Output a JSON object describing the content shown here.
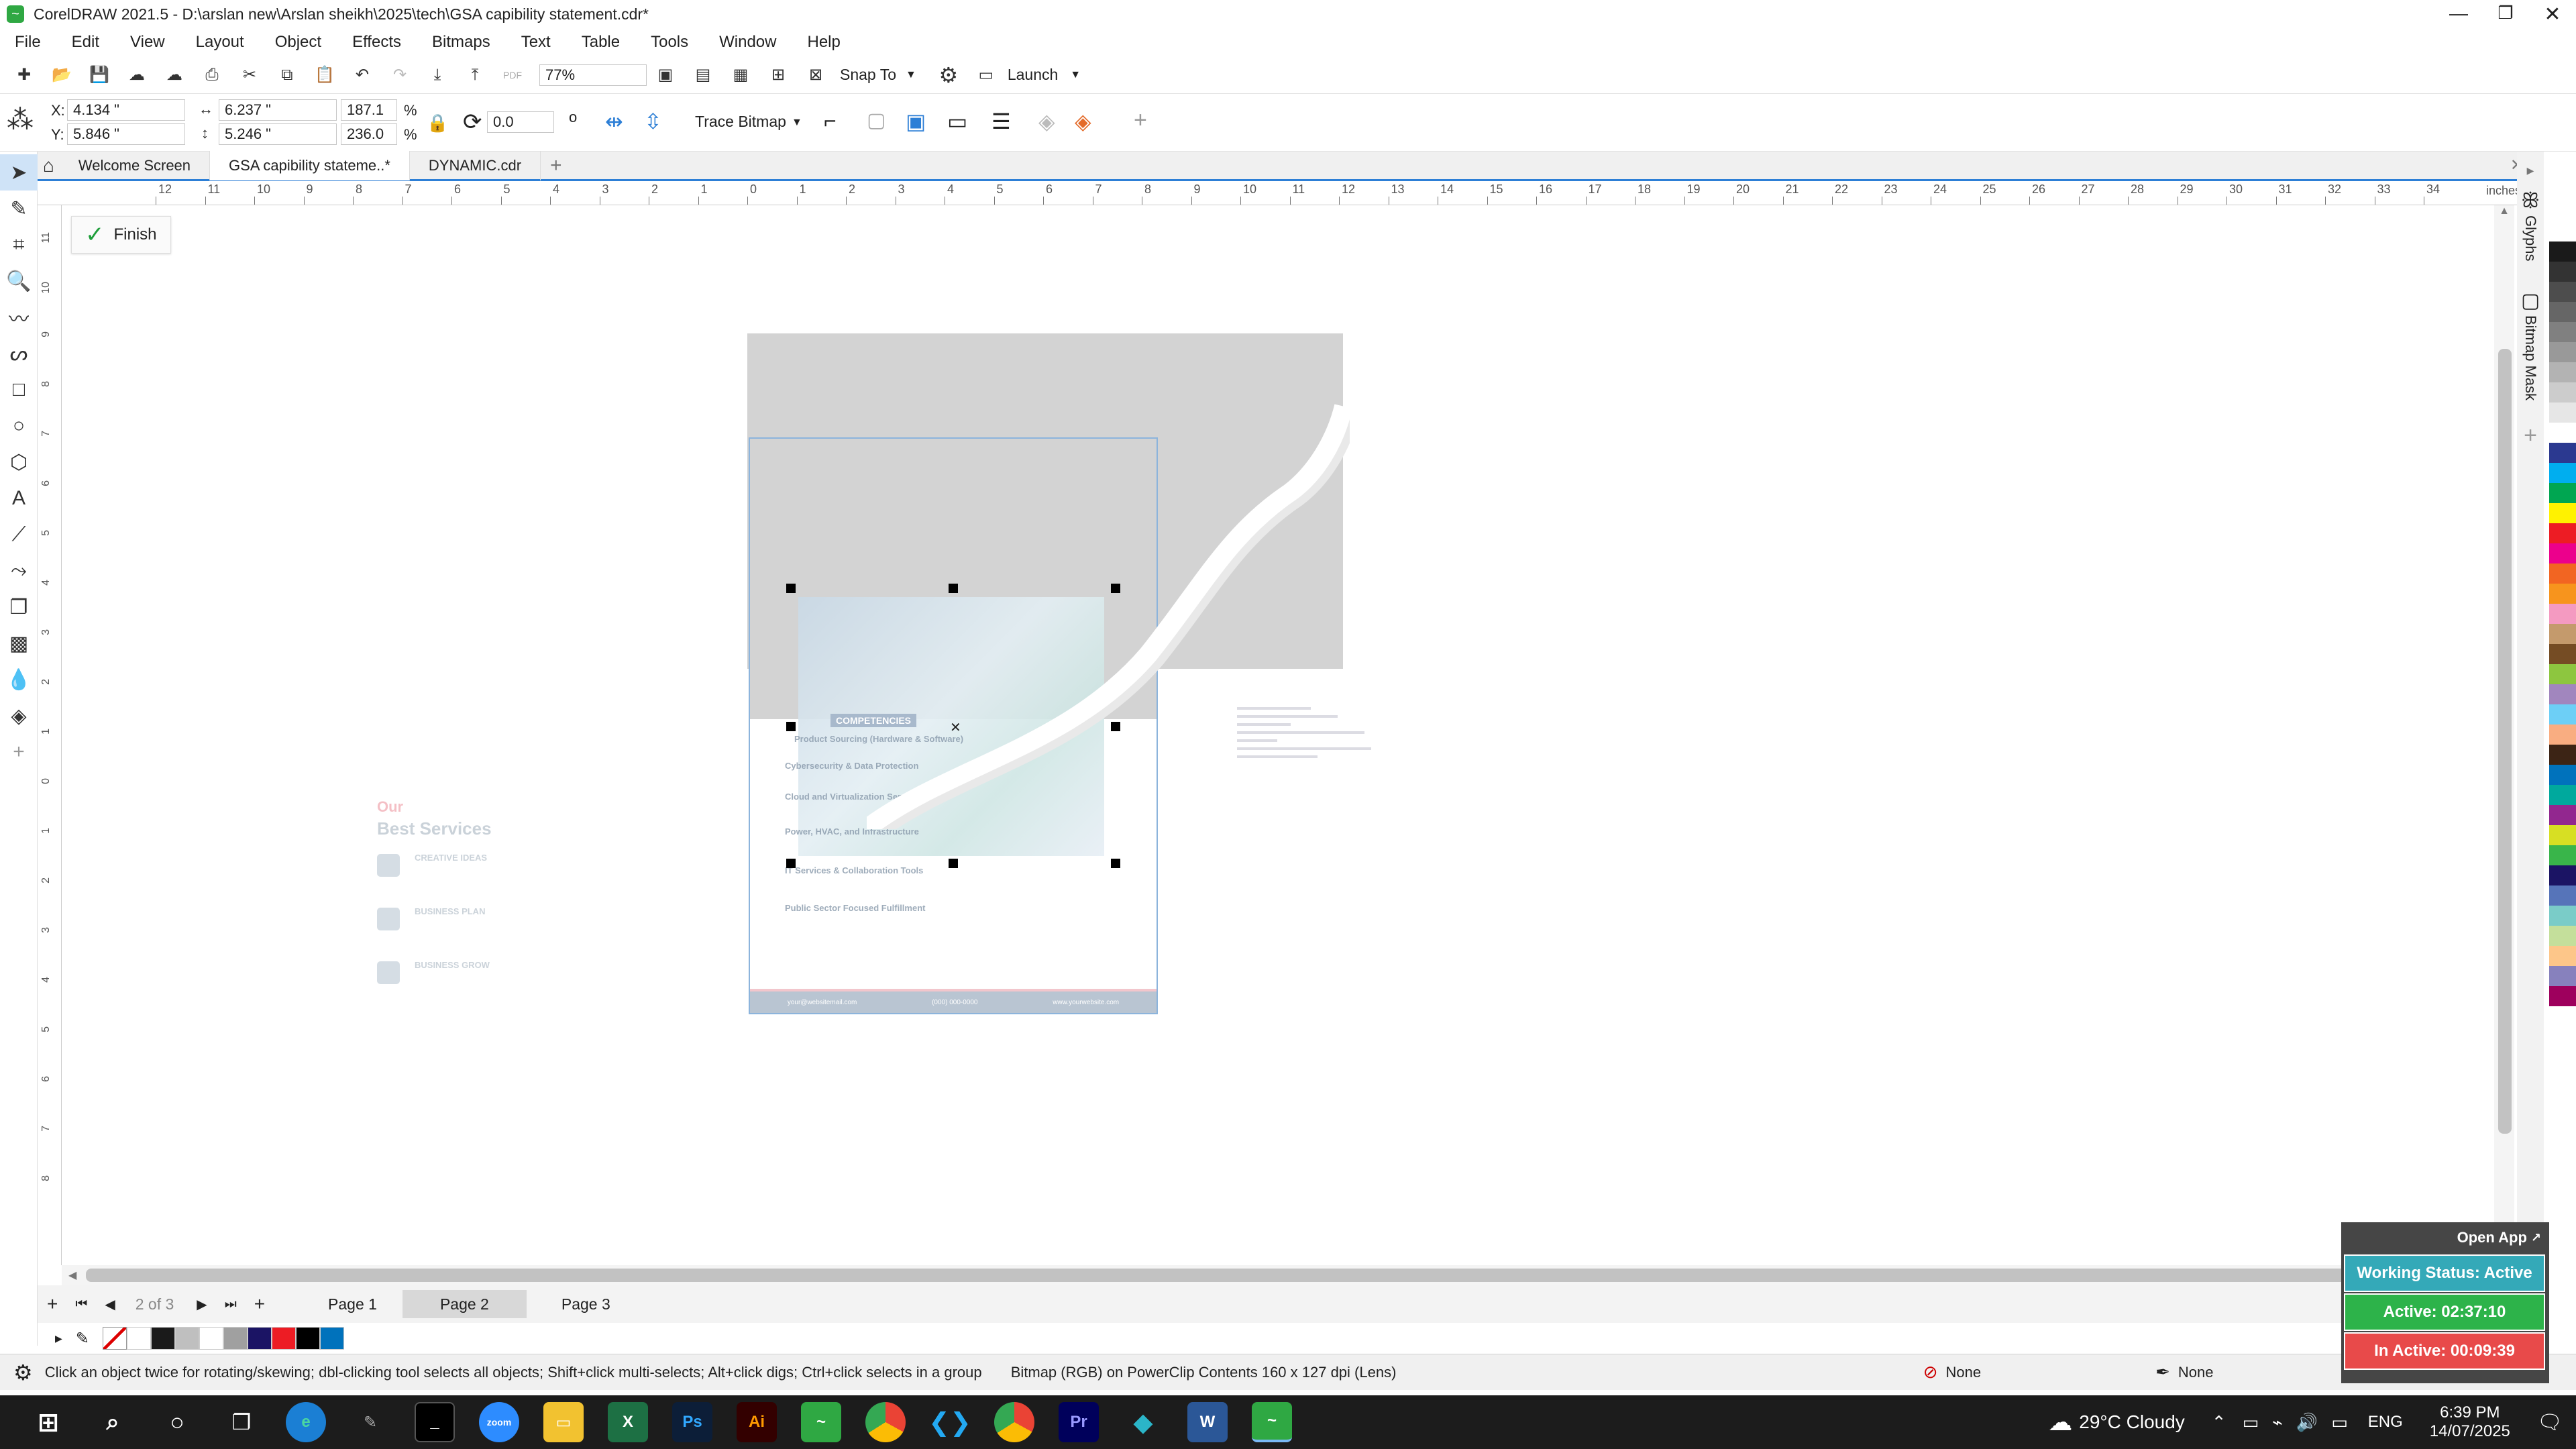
{
  "window": {
    "title": "CorelDRAW 2021.5 - D:\\arslan new\\Arslan sheikh\\2025\\tech\\GSA  capibility statement.cdr*"
  },
  "menu": [
    "File",
    "Edit",
    "View",
    "Layout",
    "Object",
    "Effects",
    "Bitmaps",
    "Text",
    "Table",
    "Tools",
    "Window",
    "Help"
  ],
  "toolbar": {
    "zoom": "77%",
    "snap_to": "Snap To",
    "launch": "Launch"
  },
  "properties": {
    "x_label": "X:",
    "x": "4.134 \"",
    "y_label": "Y:",
    "y": "5.846 \"",
    "w": "6.237 \"",
    "h": "5.246 \"",
    "scale_w": "187.1",
    "scale_h": "236.0",
    "pct": "%",
    "rotation": "0.0",
    "degree_symbol": "o",
    "trace_bitmap": "Trace Bitmap"
  },
  "doc_tabs": [
    "Welcome Screen",
    "GSA  capibility stateme..*",
    "DYNAMIC.cdr"
  ],
  "ruler": {
    "unit": "inches",
    "labels": [
      "12",
      "11",
      "10",
      "9",
      "8",
      "7",
      "6",
      "5",
      "4",
      "3",
      "2",
      "1",
      "0",
      "1",
      "2",
      "3",
      "4",
      "5",
      "6",
      "7",
      "8",
      "9",
      "10",
      "11",
      "12",
      "13",
      "14",
      "15",
      "16",
      "17",
      "18",
      "19",
      "20",
      "21",
      "22",
      "23",
      "24",
      "25",
      "26",
      "27",
      "28",
      "29",
      "30",
      "31",
      "32",
      "33",
      "34"
    ],
    "vlabels": [
      "11",
      "10",
      "9",
      "8",
      "7",
      "6",
      "5",
      "4",
      "3",
      "2",
      "1",
      "0",
      "1",
      "2",
      "3",
      "4",
      "5",
      "6",
      "7",
      "8"
    ],
    "v_unit": "inches"
  },
  "finish_label": "Finish",
  "offpage": {
    "our": "Our",
    "best": "Best Services",
    "items": [
      "CREATIVE IDEAS",
      "BUSINESS PLAN",
      "BUSINESS GROW"
    ]
  },
  "page_content": {
    "section": "COMPETENCIES",
    "items": [
      "Product Sourcing (Hardware & Software)",
      "Cybersecurity & Data Protection",
      "Cloud and Virtualization Services",
      "Power, HVAC, and Infrastructure",
      "IT Services & Collaboration Tools",
      "Public Sector Focused Fulfillment"
    ],
    "footer": [
      "your@websitemail.com",
      "(000) 000-0000",
      "www.yourwebsite.com"
    ]
  },
  "docker_tabs": [
    "Glyphs",
    "Bitmap Mask"
  ],
  "palette_colors": [
    "#1a1a1a",
    "#333333",
    "#4d4d4d",
    "#666666",
    "#808080",
    "#999999",
    "#b3b3b3",
    "#cccccc",
    "#e6e6e6",
    "#ffffff",
    "#2b3990",
    "#00aeef",
    "#00a651",
    "#fff200",
    "#ed1c24",
    "#ec008c",
    "#f26522",
    "#f7941d",
    "#f49ac1",
    "#c49a6c",
    "#754c24",
    "#8dc63f",
    "#a186be",
    "#6dcff6",
    "#f9ad81",
    "#3c2415",
    "#0072bc",
    "#00a99d",
    "#92278f",
    "#d7df23",
    "#39b54a",
    "#1b1464",
    "#5674b9",
    "#7accc8",
    "#c4df9b",
    "#fdc689",
    "#8781bd",
    "#9e005d"
  ],
  "pages": {
    "counter": "2 of 3",
    "tabs": [
      "Page 1",
      "Page 2",
      "Page 3"
    ],
    "active": "Page 2"
  },
  "doc_palette": [
    "#ffffff",
    "#1a1a1a",
    "#bfbfbf",
    "#ffffff",
    "#a0a0a0",
    "#1b1464",
    "#ed1c24",
    "#000000",
    "#0072bc"
  ],
  "status": {
    "hint": "Click an object twice for rotating/skewing; dbl-clicking tool selects all objects; Shift+click multi-selects; Alt+click digs; Ctrl+click selects in a group",
    "object": "Bitmap (RGB) on PowerClip Contents 160 x 127 dpi  (Lens)",
    "fill": "None",
    "outline": "None"
  },
  "tracker": {
    "open_app": "Open App",
    "working": "Working Status: Active",
    "active": "Active: 02:37:10",
    "inactive": "In Active: 00:09:39"
  },
  "taskbar": {
    "weather": "29°C  Cloudy",
    "lang": "ENG",
    "time": "6:39 PM",
    "date": "14/07/2025"
  }
}
